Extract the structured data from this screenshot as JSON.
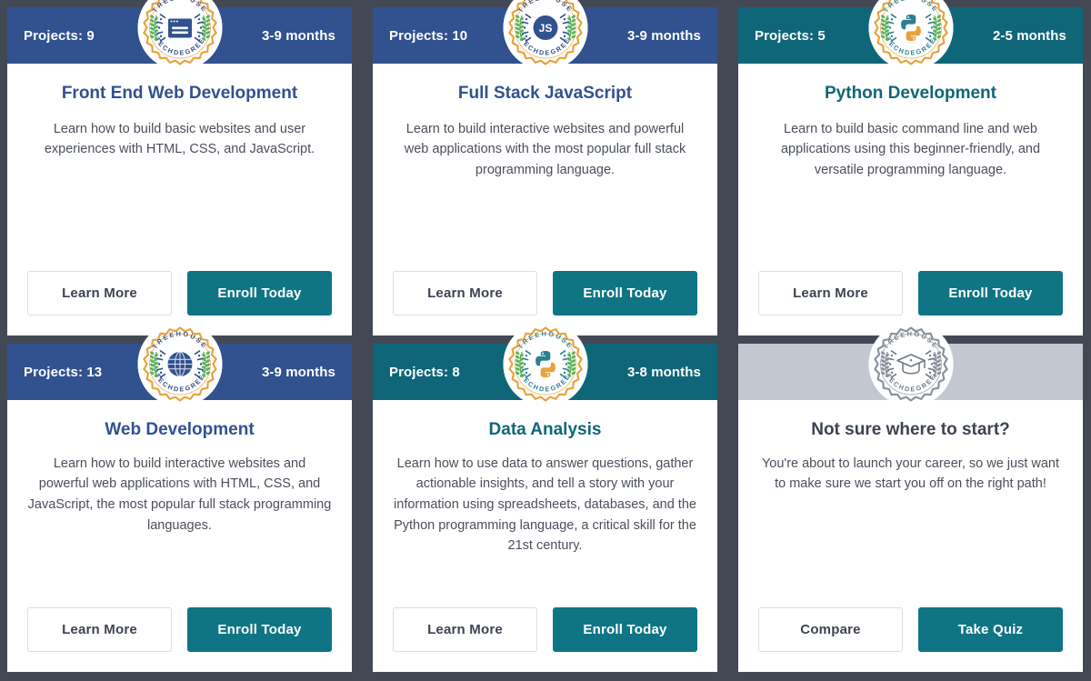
{
  "page": {
    "background_color": "#434954",
    "card_background": "#ffffff"
  },
  "palette": {
    "header_blue": "#31518F",
    "header_teal": "#0F6678",
    "header_gray": "#C3C8D0",
    "primary_button": "#0F7585",
    "secondary_button_border": "#DCDEE2",
    "body_text": "#4A4F5C",
    "badge_ring_gold": "#E8A33D",
    "badge_laurel_green": "#5DB15B",
    "badge_laurel_teal": "#3E9D9B",
    "badge_gray": "#6E7785"
  },
  "badge": {
    "top_arc_text": "TREEHOUSE",
    "bottom_arc_text": "TECHDEGREE"
  },
  "cards": [
    {
      "id": "front-end-web-development",
      "header_style": "blue",
      "projects_label": "Projects: 9",
      "duration_label": "3-9 months",
      "badge_icon": "browser-window-icon",
      "badge_theme": "blue",
      "title": "Front End Web Development",
      "title_style": "blue",
      "description": "Learn how to build basic websites and user experiences with HTML, CSS, and JavaScript.",
      "secondary_button": "Learn More",
      "primary_button": "Enroll Today"
    },
    {
      "id": "full-stack-javascript",
      "header_style": "blue",
      "projects_label": "Projects: 10",
      "duration_label": "3-9 months",
      "badge_icon": "js-logo-icon",
      "badge_theme": "blue",
      "title": "Full Stack JavaScript",
      "title_style": "blue",
      "description": "Learn to build interactive websites and powerful web applications with the most popular full stack programming language.",
      "secondary_button": "Learn More",
      "primary_button": "Enroll Today"
    },
    {
      "id": "python-development",
      "header_style": "teal",
      "projects_label": "Projects: 5",
      "duration_label": "2-5 months",
      "badge_icon": "python-logo-icon",
      "badge_theme": "teal",
      "title": "Python Development",
      "title_style": "teal",
      "description": "Learn to build basic command line and web applications using this beginner-friendly, and versatile programming language.",
      "secondary_button": "Learn More",
      "primary_button": "Enroll Today"
    },
    {
      "id": "web-development",
      "header_style": "blue",
      "projects_label": "Projects: 13",
      "duration_label": "3-9 months",
      "badge_icon": "globe-icon",
      "badge_theme": "blue",
      "title": "Web Development",
      "title_style": "blue",
      "description": "Learn how to build interactive websites and powerful web applications with HTML, CSS, and JavaScript, the most popular full stack programming languages.",
      "secondary_button": "Learn More",
      "primary_button": "Enroll Today"
    },
    {
      "id": "data-analysis",
      "header_style": "teal",
      "projects_label": "Projects: 8",
      "duration_label": "3-8 months",
      "badge_icon": "python-logo-icon",
      "badge_theme": "teal",
      "title": "Data Analysis",
      "title_style": "teal",
      "description": "Learn how to use data to answer questions, gather actionable insights, and tell a story with your information using spreadsheets, databases, and the Python programming language, a critical skill for the 21st century.",
      "secondary_button": "Learn More",
      "primary_button": "Enroll Today"
    },
    {
      "id": "not-sure-where-to-start",
      "header_style": "gray",
      "projects_label": "",
      "duration_label": "",
      "badge_icon": "graduation-cap-icon",
      "badge_theme": "gray",
      "title": "Not sure where to start?",
      "title_style": "dark",
      "description": "You're about to launch your career, so we just want to make sure we start you off on the right path!",
      "secondary_button": "Compare",
      "primary_button": "Take Quiz"
    }
  ]
}
